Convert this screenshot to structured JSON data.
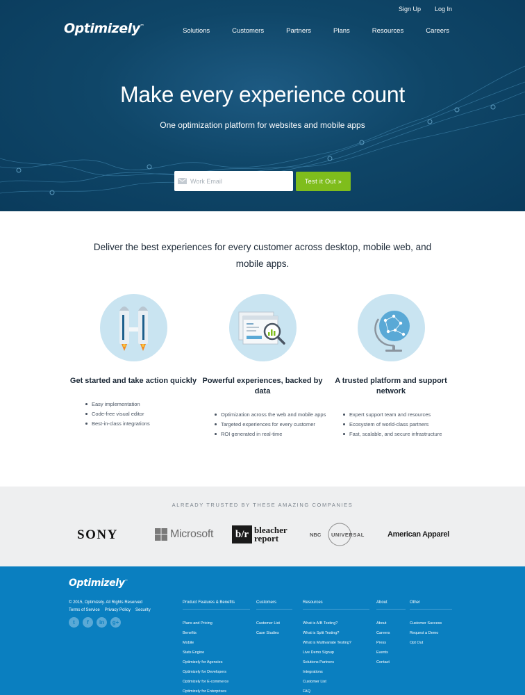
{
  "header": {
    "logo": "Optimizely",
    "top_links": [
      "Sign Up",
      "Log In"
    ],
    "nav": [
      "Solutions",
      "Customers",
      "Partners",
      "Plans",
      "Resources",
      "Careers"
    ]
  },
  "hero": {
    "title": "Make every experience count",
    "subtitle": "One optimization platform for websites and mobile apps",
    "email_placeholder": "Work Email",
    "cta_label": "Test it Out »"
  },
  "features": {
    "headline": "Deliver the best experiences for every customer across desktop, mobile web, and mobile apps.",
    "items": [
      {
        "icon": "rocket-icon",
        "title": "Get started and take action quickly",
        "bullets": [
          "Easy implementation",
          "Code-free visual editor",
          "Best-in-class integrations"
        ]
      },
      {
        "icon": "analytics-magnifier-icon",
        "title": "Powerful experiences, backed by data",
        "bullets": [
          "Optimization across the web and mobile apps",
          "Targeted experiences for every customer",
          "ROI generated in real-time"
        ]
      },
      {
        "icon": "globe-icon",
        "title": "A trusted platform and support network",
        "bullets": [
          "Expert support team and resources",
          "Ecosystem of world-class partners",
          "Fast, scalable, and secure infrastructure"
        ]
      }
    ]
  },
  "trusted": {
    "title": "ALREADY TRUSTED BY THESE AMAZING COMPANIES",
    "brands": [
      "SONY",
      "Microsoft",
      "bleacher report",
      "NBC UNIVERSAL",
      "American Apparel"
    ],
    "bleacher_mark": "b/r",
    "bleacher_line1": "bleacher",
    "bleacher_line2": "report",
    "nbc_left": "NBC",
    "nbc_right": "UNIVERSAL"
  },
  "footer": {
    "logo": "Optimizely",
    "copyright": "© 2015, Optimizely. All Rights Reserved",
    "legal": [
      "Terms of Service",
      "Privacy Policy",
      "Security"
    ],
    "social": [
      "twitter-icon",
      "facebook-icon",
      "linkedin-icon",
      "googleplus-icon"
    ],
    "social_glyphs": [
      "t",
      "f",
      "in",
      "g+"
    ],
    "columns": [
      {
        "heading": "Product Features & Benefits",
        "links": [
          "Plans and Pricing",
          "Benefits",
          "Mobile",
          "Stats Engine",
          "Optimizely for Agencies",
          "Optimizely for Developers",
          "Optimizely for E-commerce",
          "Optimizely for Enterprises"
        ]
      },
      {
        "heading": "Customers",
        "links": [
          "Customer List",
          "Case Studies"
        ]
      },
      {
        "heading": "Resources",
        "links": [
          "What is A/B Testing?",
          "What is Split Testing?",
          "What is Multivariate Testing?",
          "Live Demo Signup",
          "Solutions Partners",
          "Integrations",
          "Customer List",
          "FAQ"
        ]
      },
      {
        "heading": "About",
        "links": [
          "About",
          "Careers",
          "Press",
          "Events",
          "Contact"
        ]
      },
      {
        "heading": "Other",
        "links": [
          "Customer Success",
          "Request a Demo",
          "Opt Out"
        ]
      }
    ]
  },
  "colors": {
    "hero_bg": "#0f4668",
    "cta_green": "#7fbd1c",
    "feature_circle": "#c9e4f1",
    "trusted_bg": "#eeeff0",
    "footer_bg": "#0a7fc0"
  }
}
